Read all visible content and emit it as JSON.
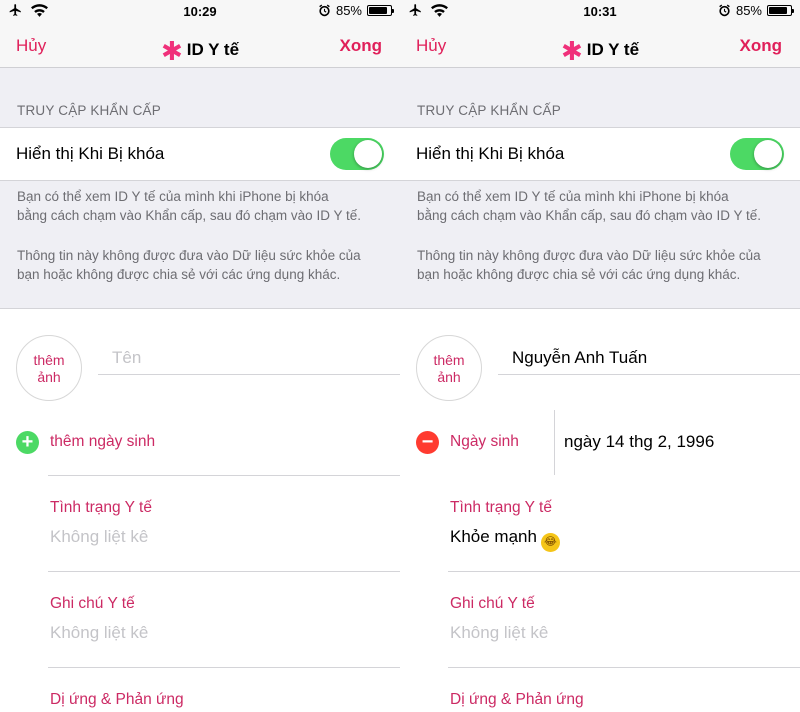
{
  "screens": [
    {
      "status": {
        "time": "10:29",
        "battery": "85%"
      },
      "nav": {
        "cancel": "Hủy",
        "title": "ID Y tế",
        "done": "Xong"
      },
      "section_header": "TRUY CẬP KHẨN CẤP",
      "toggle": {
        "label": "Hiển thị Khi Bị khóa",
        "on": true
      },
      "footer": [
        "Bạn có thể xem ID Y tế của mình khi iPhone bị khóa",
        "bằng cách chạm vào Khẩn cấp, sau đó chạm vào ID Y tế.",
        "Thông tin này không được đưa vào Dữ liệu sức khỏe của",
        "bạn hoặc không được chia sẻ với các ứng dụng khác."
      ],
      "avatar": {
        "line1": "thêm",
        "line2": "ảnh"
      },
      "name": {
        "placeholder": "Tên",
        "value": ""
      },
      "dob": {
        "label": "thêm ngày sinh",
        "value": ""
      },
      "conditions": {
        "label": "Tình trạng Y tế",
        "value": "Không liệt kê"
      },
      "notes": {
        "label": "Ghi chú Y tế",
        "value": "Không liệt kê"
      },
      "allergies": {
        "label": "Dị ứng & Phản ứng"
      }
    },
    {
      "status": {
        "time": "10:31",
        "battery": "85%"
      },
      "nav": {
        "cancel": "Hủy",
        "title": "ID Y tế",
        "done": "Xong"
      },
      "section_header": "TRUY CẬP KHẨN CẤP",
      "toggle": {
        "label": "Hiển thị Khi Bị khóa",
        "on": true
      },
      "footer": [
        "Bạn có thể xem ID Y tế của mình khi iPhone bị khóa",
        "bằng cách chạm vào Khẩn cấp, sau đó chạm vào ID Y tế.",
        "Thông tin này không được đưa vào Dữ liệu sức khỏe của",
        "bạn hoặc không được chia sẻ với các ứng dụng khác."
      ],
      "avatar": {
        "line1": "thêm",
        "line2": "ảnh"
      },
      "name": {
        "placeholder": "Tên",
        "value": "Nguyễn Anh Tuấn"
      },
      "dob": {
        "label": "Ngày sinh",
        "value": "ngày 14 thg 2, 1996"
      },
      "conditions": {
        "label": "Tình trạng Y tế",
        "value": "Khỏe mạnh"
      },
      "notes": {
        "label": "Ghi chú Y tế",
        "value": "Không liệt kê"
      },
      "allergies": {
        "label": "Dị ứng & Phản ứng"
      }
    }
  ],
  "colors": {
    "accent": "#e0205a",
    "label_pink": "#cc2a64",
    "switch_on": "#4cd964",
    "add_green": "#4cd964",
    "remove_red": "#ff3b30",
    "grouped_bg": "#efeff4"
  },
  "icons": [
    "airplane-icon",
    "wifi-icon",
    "alarm-icon",
    "battery-icon",
    "medical-star-icon",
    "add-circle-icon",
    "remove-circle-icon",
    "laughing-emoji-icon"
  ]
}
